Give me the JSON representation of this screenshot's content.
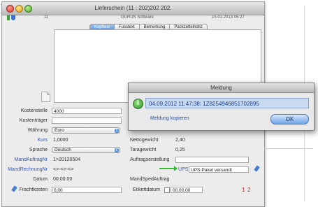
{
  "window": {
    "title": "Lieferschein (11 : 202)202 202.",
    "sub_left": "11",
    "sub_mid": "GURUS Software",
    "sub_right": "15.01.2013 05:27"
  },
  "tabs": [
    {
      "label": "Kopftext"
    },
    {
      "label": "Fusstext"
    },
    {
      "label": "Bemerkung"
    },
    {
      "label": "Packzettelnotiz"
    }
  ],
  "form": {
    "kostenstelle_label": "Kostenstelle",
    "kostenstelle_value": "4000",
    "kostentraeger_label": "Kostenträger",
    "kostentraeger_value": "",
    "waehrung_label": "Währung",
    "waehrung_value": "Euro",
    "kurs_label": "Kurs",
    "kurs_value": "1,0000",
    "sprache_label": "Sprache",
    "sprache_value": "Deutsch",
    "mandauftrag_label": "MandAuftragNr",
    "mandauftrag_value": "1>20120504",
    "mandrechnung_label": "MandRechnungNr",
    "mandrechnung_value": "<>-<>-<>",
    "datum_label": "Datum",
    "datum_value": "00.00.00",
    "frachtkosten_label": "Frachtkosten",
    "frachtkosten_value": "0,00",
    "nettogewicht_label": "Nettogewicht",
    "nettogewicht_value": "2,40",
    "taragewicht_label": "Taragewicht",
    "taragewicht_value": "0,25",
    "auftrag_label": "Auftragserstellung",
    "ups_label": "UPS",
    "ups_value": "UPS-Paket versandt",
    "mandspedauftrag_label": "MandSpedAuftrag",
    "etikett_label": "Etikettdatum",
    "etikett_value": "00.00.00",
    "counter_1": "1",
    "counter_2": "2"
  },
  "dialog": {
    "title": "Meldung",
    "message": "04.09.2012 11:47:38: 1Z8254946851702895",
    "copy_link": "Meldung kopieren",
    "ok_label": "OK"
  },
  "colors": {
    "accent": "#5b93dc",
    "link": "#2a56c6",
    "message_bg": "#c9d9ef",
    "warning_red": "#d02020",
    "arrow_green": "#2fbf2f"
  }
}
